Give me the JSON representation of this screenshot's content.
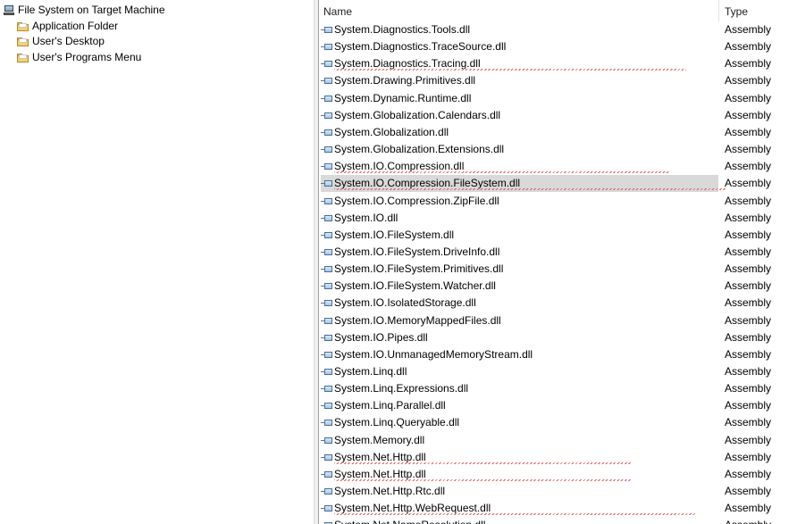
{
  "tree": {
    "root": {
      "label": "File System on Target Machine",
      "icon": "computer-icon"
    },
    "children": [
      {
        "label": "Application Folder",
        "icon": "folder-icon"
      },
      {
        "label": "User's Desktop",
        "icon": "folder-icon"
      },
      {
        "label": "User's Programs Menu",
        "icon": "folder-icon"
      }
    ]
  },
  "list": {
    "columns": {
      "name": "Name",
      "type": "Type"
    },
    "rows": [
      {
        "name": "System.Diagnostics.Tools.dll",
        "type": "Assembly"
      },
      {
        "name": "System.Diagnostics.TraceSource.dll",
        "type": "Assembly"
      },
      {
        "name": "System.Diagnostics.Tracing.dll",
        "type": "Assembly",
        "warning": true
      },
      {
        "name": "System.Drawing.Primitives.dll",
        "type": "Assembly"
      },
      {
        "name": "System.Dynamic.Runtime.dll",
        "type": "Assembly"
      },
      {
        "name": "System.Globalization.Calendars.dll",
        "type": "Assembly"
      },
      {
        "name": "System.Globalization.dll",
        "type": "Assembly"
      },
      {
        "name": "System.Globalization.Extensions.dll",
        "type": "Assembly"
      },
      {
        "name": "System.IO.Compression.dll",
        "type": "Assembly",
        "warning": true
      },
      {
        "name": "System.IO.Compression.FileSystem.dll",
        "type": "Assembly",
        "selected": true,
        "warning": true
      },
      {
        "name": "System.IO.Compression.ZipFile.dll",
        "type": "Assembly"
      },
      {
        "name": "System.IO.dll",
        "type": "Assembly"
      },
      {
        "name": "System.IO.FileSystem.dll",
        "type": "Assembly"
      },
      {
        "name": "System.IO.FileSystem.DriveInfo.dll",
        "type": "Assembly"
      },
      {
        "name": "System.IO.FileSystem.Primitives.dll",
        "type": "Assembly"
      },
      {
        "name": "System.IO.FileSystem.Watcher.dll",
        "type": "Assembly"
      },
      {
        "name": "System.IO.IsolatedStorage.dll",
        "type": "Assembly"
      },
      {
        "name": "System.IO.MemoryMappedFiles.dll",
        "type": "Assembly"
      },
      {
        "name": "System.IO.Pipes.dll",
        "type": "Assembly"
      },
      {
        "name": "System.IO.UnmanagedMemoryStream.dll",
        "type": "Assembly"
      },
      {
        "name": "System.Linq.dll",
        "type": "Assembly"
      },
      {
        "name": "System.Linq.Expressions.dll",
        "type": "Assembly"
      },
      {
        "name": "System.Linq.Parallel.dll",
        "type": "Assembly"
      },
      {
        "name": "System.Linq.Queryable.dll",
        "type": "Assembly"
      },
      {
        "name": "System.Memory.dll",
        "type": "Assembly"
      },
      {
        "name": "System.Net.Http.dll",
        "type": "Assembly",
        "warning": true
      },
      {
        "name": "System.Net.Http.dll",
        "type": "Assembly",
        "warning": true
      },
      {
        "name": "System.Net.Http.Rtc.dll",
        "type": "Assembly"
      },
      {
        "name": "System.Net.Http.WebRequest.dll",
        "type": "Assembly",
        "warning": true
      },
      {
        "name": "System.Net.NameResolution.dll",
        "type": "Assembly"
      }
    ]
  },
  "colors": {
    "selection": "#d9d9d9",
    "warning_underline": "#e35656",
    "folder": "#f5d074"
  }
}
